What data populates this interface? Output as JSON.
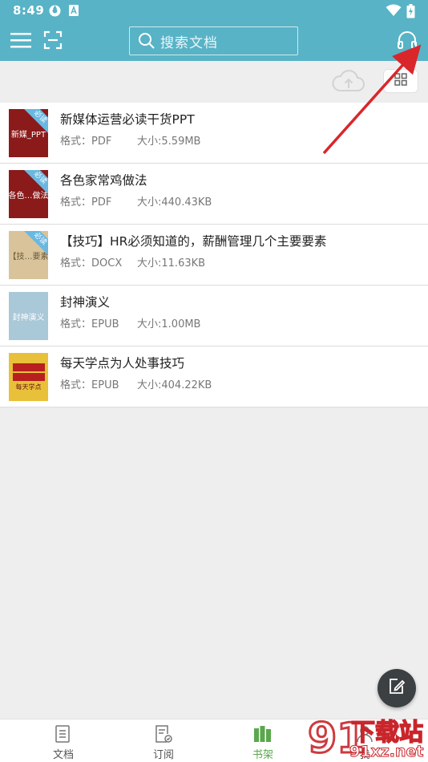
{
  "status": {
    "time": "8:49"
  },
  "header": {
    "search_placeholder": "搜索文档",
    "icons": {
      "menu": "menu-icon",
      "scan": "scan-icon",
      "search": "search-icon",
      "headphones": "headphones-icon"
    }
  },
  "toolbar": {
    "upload_icon": "cloud-upload-icon",
    "grid_icon": "grid-view-icon"
  },
  "documents": [
    {
      "title": "新媒体运营必读干货PPT",
      "format_label": "格式：",
      "format": "PDF",
      "size_label": "大小:",
      "size": "5.59MB",
      "cover_text": "新媒_PPT",
      "cover_color": "#8b1a1a",
      "tag": "必读"
    },
    {
      "title": "各色家常鸡做法",
      "format_label": "格式：",
      "format": "PDF",
      "size_label": "大小:",
      "size": "440.43KB",
      "cover_text": "各色…做法",
      "cover_color": "#8b1a1a",
      "tag": "必读"
    },
    {
      "title": "【技巧】HR必须知道的，薪酬管理几个主要要素",
      "format_label": "格式：",
      "format": "DOCX",
      "size_label": "大小:",
      "size": "11.63KB",
      "cover_text": "【技…要素",
      "cover_color": "#d8c39a",
      "tag": "必读"
    },
    {
      "title": "封神演义",
      "format_label": "格式：",
      "format": "EPUB",
      "size_label": "大小:",
      "size": "1.00MB",
      "cover_text": "封神演义",
      "cover_color": "#a9c8d8",
      "tag": ""
    },
    {
      "title": "每天学点为人处事技巧",
      "format_label": "格式：",
      "format": "EPUB",
      "size_label": "大小:",
      "size": "404.22KB",
      "cover_text": "每天学点",
      "cover_color": "#e8c03a",
      "tag": ""
    }
  ],
  "fab": {
    "icon": "edit-icon"
  },
  "nav": {
    "tabs": [
      {
        "label": "文档",
        "icon": "document-icon"
      },
      {
        "label": "订阅",
        "icon": "subscribe-icon"
      },
      {
        "label": "书架",
        "icon": "bookshelf-icon",
        "active": true
      },
      {
        "label": "我",
        "icon": "profile-icon"
      }
    ]
  },
  "watermark": {
    "brand": "下载站",
    "site": "91xz.net"
  },
  "colors": {
    "primary": "#58b3c6",
    "active_tab": "#5aa84c",
    "annotation_arrow": "#d9262b"
  }
}
